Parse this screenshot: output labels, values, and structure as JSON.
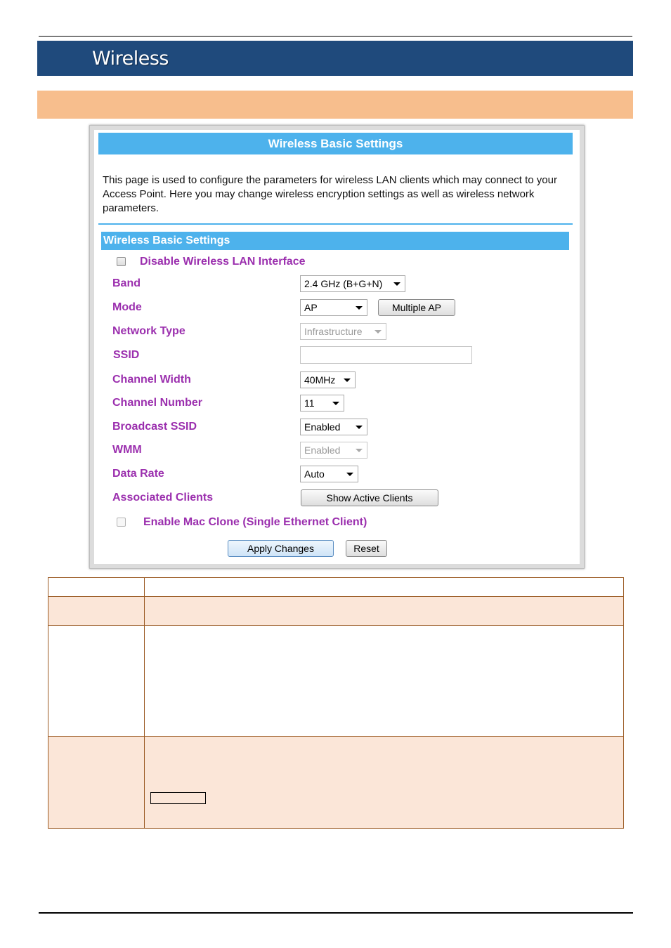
{
  "header": {
    "section_title": "Wireless"
  },
  "screenshot": {
    "page_title": "Wireless Basic Settings",
    "intro": "This page is used to configure the parameters for wireless LAN clients which may connect to your Access Point. Here you may change wireless encryption settings as well as wireless network parameters.",
    "section_title": "Wireless Basic Settings",
    "disable_wireless_label": "Disable Wireless LAN Interface",
    "disable_wireless_checked": false,
    "fields": {
      "band": {
        "label": "Band",
        "value": "2.4 GHz (B+G+N)"
      },
      "mode": {
        "label": "Mode",
        "value": "AP",
        "button": "Multiple AP"
      },
      "network_type": {
        "label": "Network Type",
        "value": "Infrastructure",
        "disabled": true
      },
      "ssid": {
        "label": "SSID",
        "value": ""
      },
      "channel_width": {
        "label": "Channel Width",
        "value": "40MHz"
      },
      "channel_number": {
        "label": "Channel Number",
        "value": "11"
      },
      "broadcast_ssid": {
        "label": "Broadcast SSID",
        "value": "Enabled"
      },
      "wmm": {
        "label": "WMM",
        "value": "Enabled",
        "disabled": true
      },
      "data_rate": {
        "label": "Data Rate",
        "value": "Auto"
      },
      "associated_clients": {
        "label": "Associated Clients",
        "button": "Show Active Clients"
      }
    },
    "mac_clone_label": "Enable Mac Clone (Single Ethernet Client)",
    "mac_clone_checked": false,
    "buttons": {
      "apply": "Apply Changes",
      "reset": "Reset"
    }
  },
  "colors": {
    "banner": "#1f4a7c",
    "sub_banner": "#f7be8d",
    "title_bar": "#4db2ec",
    "label": "#9b2fae",
    "table_border": "#9b5a23",
    "table_tint": "#fbe6d8"
  }
}
